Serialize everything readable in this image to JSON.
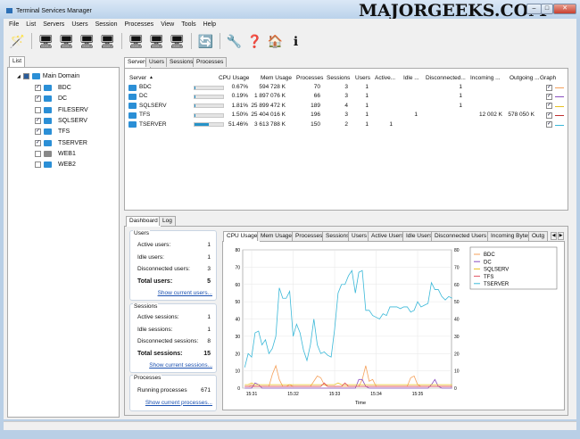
{
  "window": {
    "title": "Terminal Services Manager",
    "watermark": "MAJORGEEKS.COM",
    "minimize": "–",
    "maximize": "□",
    "close": "✕"
  },
  "menu": [
    "File",
    "List",
    "Servers",
    "Users",
    "Session",
    "Processes",
    "View",
    "Tools",
    "Help"
  ],
  "toolbar": [
    {
      "icon": "magic-wand-icon",
      "g": "🪄"
    },
    {
      "sep": true
    },
    {
      "icon": "add-server-icon",
      "g": "🖥"
    },
    {
      "icon": "add-group-icon",
      "g": "🖥"
    },
    {
      "icon": "edit-server-icon",
      "g": "🖥"
    },
    {
      "icon": "remove-server-icon",
      "g": "🖥"
    },
    {
      "sep": true
    },
    {
      "icon": "check-servers-icon",
      "g": "🖥"
    },
    {
      "icon": "uncheck-servers-icon",
      "g": "🖥"
    },
    {
      "icon": "toggle-check-icon",
      "g": "🖥"
    },
    {
      "sep": true
    },
    {
      "icon": "refresh-icon",
      "g": "🔄"
    },
    {
      "sep": true
    },
    {
      "icon": "wrench-icon",
      "g": "🔧"
    },
    {
      "icon": "help-icon",
      "g": "❓"
    },
    {
      "icon": "home-icon",
      "g": "🏠"
    },
    {
      "icon": "info-icon",
      "g": "ℹ"
    }
  ],
  "left": {
    "tab": "List",
    "root": "Main Domain",
    "servers": [
      {
        "name": "BDC",
        "checked": true
      },
      {
        "name": "DC",
        "checked": true
      },
      {
        "name": "FILESERV",
        "checked": false
      },
      {
        "name": "SQLSERV",
        "checked": true
      },
      {
        "name": "TFS",
        "checked": true
      },
      {
        "name": "TSERVER",
        "checked": true
      },
      {
        "name": "WEB1",
        "checked": false
      },
      {
        "name": "WEB2",
        "checked": false
      }
    ]
  },
  "top_tabs": [
    "Servers",
    "Users",
    "Sessions",
    "Processes"
  ],
  "columns": [
    "Server",
    "CPU Usage",
    "Mem Usage",
    "Processes",
    "Sessions",
    "Users",
    "Active...",
    "Idle ...",
    "Disconnected...",
    "Incoming ...",
    "Outgoing ...",
    "Graph"
  ],
  "rows": [
    {
      "server": "BDC",
      "cpu": "0.67%",
      "cpu_pct": 0.67,
      "mem": "594 728 K",
      "proc": "70",
      "sess": "3",
      "users": "1",
      "active": "",
      "idle": "",
      "disc": "1",
      "in": "",
      "out": "",
      "graph": true,
      "color": "#f5a05a"
    },
    {
      "server": "DC",
      "cpu": "0.19%",
      "cpu_pct": 0.19,
      "mem": "1 897 076 K",
      "proc": "66",
      "sess": "3",
      "users": "1",
      "active": "",
      "idle": "",
      "disc": "1",
      "in": "",
      "out": "",
      "graph": true,
      "color": "#8a4fc0"
    },
    {
      "server": "SQLSERV",
      "cpu": "1.81%",
      "cpu_pct": 1.81,
      "mem": "25 899 472 K",
      "proc": "189",
      "sess": "4",
      "users": "1",
      "active": "",
      "idle": "",
      "disc": "1",
      "in": "",
      "out": "",
      "graph": true,
      "color": "#e8c020"
    },
    {
      "server": "TFS",
      "cpu": "1.50%",
      "cpu_pct": 1.5,
      "mem": "25 404 016 K",
      "proc": "196",
      "sess": "3",
      "users": "1",
      "active": "",
      "idle": "1",
      "disc": "",
      "in": "12 002 K",
      "out": "578 050 K",
      "graph": true,
      "color": "#c03030"
    },
    {
      "server": "TSERVER",
      "cpu": "51.46%",
      "cpu_pct": 51.46,
      "mem": "3 613 788 K",
      "proc": "150",
      "sess": "2",
      "users": "1",
      "active": "1",
      "idle": "",
      "disc": "",
      "in": "",
      "out": "",
      "graph": true,
      "color": "#3ab8d8"
    }
  ],
  "bottom_tabs": [
    "Dashboard",
    "Log"
  ],
  "dashboard": {
    "users": {
      "title": "Users",
      "items": [
        [
          "Active users:",
          "1"
        ],
        [
          "Idle users:",
          "1"
        ],
        [
          "Disconnected users:",
          "3"
        ]
      ],
      "total": [
        "Total users:",
        "5"
      ],
      "link": "Show current users..."
    },
    "sessions": {
      "title": "Sessions",
      "items": [
        [
          "Active sessions:",
          "1"
        ],
        [
          "Idle sessions:",
          "1"
        ],
        [
          "Disconnected sessions:",
          "8"
        ]
      ],
      "total": [
        "Total sessions:",
        "15"
      ],
      "link": "Show current sessions..."
    },
    "processes": {
      "title": "Processes",
      "items": [
        [
          "Running processes",
          "671"
        ]
      ],
      "link": "Show current processes..."
    }
  },
  "chart_tabs": [
    "CPU Usage",
    "Mem Usage",
    "Processes",
    "Sessions",
    "Users",
    "Active Users",
    "Idle Users",
    "Disconnected Users",
    "Incoming Bytes",
    "Outg"
  ],
  "chart_data": {
    "type": "line",
    "xlabel": "Time",
    "ylabel": "",
    "ylim": [
      0,
      80
    ],
    "yticks": [
      0,
      10,
      20,
      30,
      40,
      50,
      60,
      70,
      80
    ],
    "xticks": [
      "15:31",
      "15:32",
      "15:33",
      "15:34",
      "15:35"
    ],
    "grid": true,
    "legend": "right",
    "x": [
      "15:30:50",
      "15:30:55",
      "15:31:00",
      "15:31:05",
      "15:31:10",
      "15:31:15",
      "15:31:20",
      "15:31:25",
      "15:31:30",
      "15:31:35",
      "15:31:40",
      "15:31:45",
      "15:31:50",
      "15:31:55",
      "15:32:00",
      "15:32:05",
      "15:32:10",
      "15:32:15",
      "15:32:20",
      "15:32:25",
      "15:32:30",
      "15:32:35",
      "15:32:40",
      "15:32:45",
      "15:32:50",
      "15:32:55",
      "15:33:00",
      "15:33:05",
      "15:33:10",
      "15:33:15",
      "15:33:20",
      "15:33:25",
      "15:33:30",
      "15:33:35",
      "15:33:40",
      "15:33:45",
      "15:33:50",
      "15:33:55",
      "15:34:00",
      "15:34:05",
      "15:34:10",
      "15:34:15",
      "15:34:20",
      "15:34:25",
      "15:34:30",
      "15:34:35",
      "15:34:40",
      "15:34:45",
      "15:34:50",
      "15:34:55",
      "15:35:00",
      "15:35:05",
      "15:35:10",
      "15:35:15",
      "15:35:20",
      "15:35:25",
      "15:35:30",
      "15:35:35",
      "15:35:40",
      "15:35:45",
      "15:35:50"
    ],
    "series": [
      {
        "name": "BDC",
        "color": "#f5a05a",
        "values": [
          1,
          1,
          2,
          1,
          1,
          1,
          1,
          1,
          8,
          13,
          5,
          1,
          1,
          2,
          1,
          1,
          1,
          1,
          1,
          1,
          4,
          7,
          6,
          2,
          1,
          1,
          1,
          1,
          1,
          1,
          1,
          1,
          1,
          1,
          5,
          13,
          4,
          5,
          1,
          1,
          1,
          1,
          1,
          1,
          1,
          1,
          1,
          1,
          6,
          7,
          2,
          1,
          1,
          1,
          1,
          1,
          1,
          1,
          1,
          1,
          1
        ]
      },
      {
        "name": "DC",
        "color": "#8a4fc0",
        "values": [
          0,
          0,
          0,
          3,
          2,
          0,
          0,
          0,
          0,
          0,
          0,
          0,
          0,
          0,
          0,
          0,
          0,
          0,
          0,
          0,
          0,
          0,
          0,
          0,
          0,
          0,
          0,
          0,
          0,
          0,
          0,
          0,
          0,
          5,
          5,
          1,
          0,
          0,
          0,
          0,
          0,
          0,
          0,
          0,
          0,
          0,
          0,
          0,
          0,
          0,
          0,
          0,
          0,
          0,
          2,
          5,
          1,
          0,
          0,
          0,
          0
        ]
      },
      {
        "name": "SQLSERV",
        "color": "#e8c020",
        "values": [
          2,
          2,
          3,
          2,
          2,
          2,
          2,
          2,
          2,
          2,
          2,
          2,
          2,
          2,
          2,
          2,
          2,
          2,
          2,
          2,
          2,
          2,
          2,
          2,
          2,
          2,
          2,
          3,
          2,
          2,
          2,
          2,
          2,
          2,
          2,
          2,
          2,
          2,
          2,
          2,
          2,
          2,
          2,
          2,
          2,
          2,
          2,
          2,
          2,
          2,
          2,
          2,
          2,
          2,
          2,
          2,
          2,
          2,
          2,
          2,
          2
        ]
      },
      {
        "name": "TFS",
        "color": "#e05060",
        "values": [
          1,
          1,
          1,
          1,
          1,
          1,
          1,
          1,
          1,
          1,
          1,
          1,
          1,
          1,
          1,
          1,
          1,
          1,
          1,
          1,
          1,
          1,
          1,
          3,
          1,
          1,
          1,
          1,
          1,
          3,
          1,
          1,
          1,
          1,
          1,
          1,
          1,
          1,
          1,
          1,
          1,
          1,
          1,
          1,
          1,
          1,
          1,
          1,
          1,
          1,
          1,
          1,
          1,
          1,
          1,
          1,
          1,
          1,
          1,
          1,
          1
        ]
      },
      {
        "name": "TSERVER",
        "color": "#3ab8d8",
        "values": [
          12,
          20,
          18,
          32,
          33,
          25,
          28,
          20,
          23,
          30,
          58,
          52,
          52,
          56,
          30,
          37,
          32,
          22,
          16,
          25,
          40,
          25,
          20,
          21,
          19,
          18,
          34,
          55,
          60,
          60,
          65,
          68,
          55,
          67,
          68,
          45,
          45,
          42,
          41,
          40,
          43,
          42,
          47,
          47,
          47,
          46,
          47,
          47,
          44,
          45,
          50,
          47,
          48,
          49,
          61,
          57,
          57,
          53,
          51,
          53,
          52
        ]
      }
    ]
  }
}
